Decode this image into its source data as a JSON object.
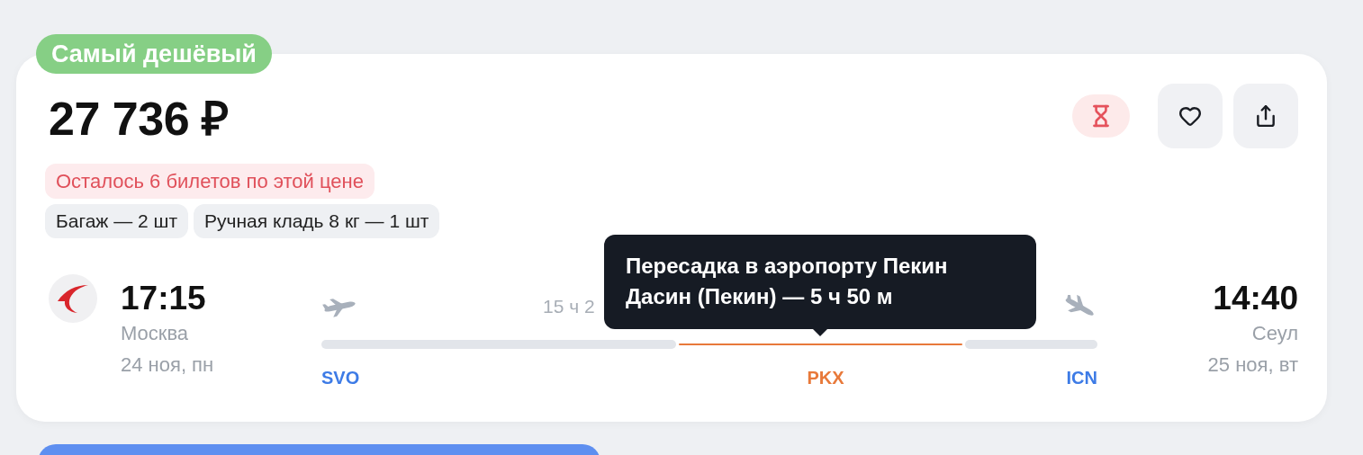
{
  "badge": {
    "label": "Самый дешёвый"
  },
  "price": "27 736 ₽",
  "urgency": "Осталось 6 билетов по этой цене",
  "tags": [
    "Багаж — 2 шт",
    "Ручная кладь 8 кг — 1 шт"
  ],
  "departure": {
    "time": "17:15",
    "city": "Москва",
    "date": "24 ноя, пн"
  },
  "duration": "15 ч 2",
  "legs": [
    {
      "kind": "flight"
    },
    {
      "kind": "layover"
    },
    {
      "kind": "flight"
    }
  ],
  "stops": [
    {
      "kind": "origin",
      "code": "SVO"
    },
    {
      "kind": "transfer",
      "code": "PKX"
    },
    {
      "kind": "destination",
      "code": "ICN"
    }
  ],
  "tooltip": {
    "text": "Пересадка в аэропорту Пекин Дасин (Пекин) — 5 ч 50 м"
  },
  "arrival": {
    "time": "14:40",
    "city": "Сеул",
    "date": "25 ноя, вт"
  }
}
